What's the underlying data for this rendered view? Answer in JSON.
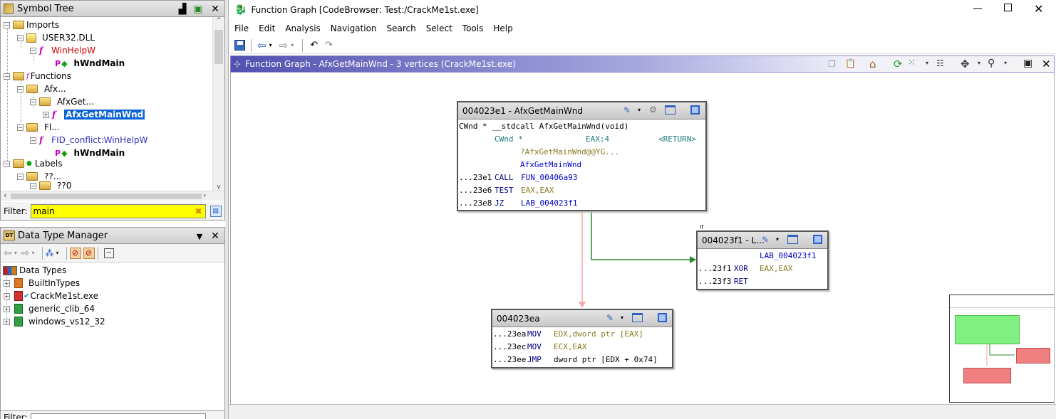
{
  "symbol_tree": {
    "title": "Symbol Tree",
    "items": [
      {
        "label": "Imports"
      },
      {
        "label": "USER32.DLL"
      },
      {
        "label": "WinHelpW"
      },
      {
        "label": "hWndMain"
      },
      {
        "label": "Functions"
      },
      {
        "label": "Afx..."
      },
      {
        "label": "AfxGet..."
      },
      {
        "label": "AfxGetMainWnd"
      },
      {
        "label": "Fl..."
      },
      {
        "label": "FID_conflict:WinHelpW"
      },
      {
        "label": "hWndMain"
      },
      {
        "label": "Labels"
      },
      {
        "label": "??..."
      },
      {
        "label": "??0"
      }
    ],
    "filter_label": "Filter:",
    "filter_value": "main"
  },
  "data_type_manager": {
    "title": "Data Type Manager",
    "root": "Data Types",
    "items": [
      {
        "label": "BuiltInTypes"
      },
      {
        "label": "CrackMe1st.exe"
      },
      {
        "label": "generic_clib_64"
      },
      {
        "label": "windows_vs12_32"
      }
    ],
    "filter_label": "Filter:"
  },
  "window": {
    "title": "Function Graph [CodeBrowser: Test:/CrackMe1st.exe]",
    "menu": [
      "File",
      "Edit",
      "Analysis",
      "Navigation",
      "Search",
      "Select",
      "Tools",
      "Help"
    ],
    "panel_title": "Function Graph - AfxGetMainWnd - 3 vertices  (CrackMe1st.exe)"
  },
  "graph": {
    "node1": {
      "title": "004023e1 - AfxGetMainWnd",
      "sig": "CWnd * __stdcall AfxGetMainWnd(void)",
      "ret_type": "CWnd *",
      "ret_loc": "EAX:4",
      "ret_name": "<RETURN>",
      "label1": "?AfxGetMainWnd@@YG...",
      "label2": "AfxGetMainWnd",
      "rows": [
        {
          "addr": "...23e1",
          "op": "CALL",
          "arg": "FUN_00406a93"
        },
        {
          "addr": "...23e6",
          "op": "TEST",
          "arg": "EAX,EAX"
        },
        {
          "addr": "...23e8",
          "op": "JZ",
          "arg": "LAB_004023f1"
        }
      ]
    },
    "node2": {
      "tag": "lf",
      "title": "004023f1 - L...",
      "label": "LAB_004023f1",
      "rows": [
        {
          "addr": "...23f1",
          "op": "XOR",
          "arg": "EAX,EAX"
        },
        {
          "addr": "...23f3",
          "op": "RET",
          "arg": ""
        }
      ]
    },
    "node3": {
      "title": "004023ea",
      "rows": [
        {
          "addr": "...23ea",
          "op": "MOV",
          "arg": "EDX,dword ptr [EAX]"
        },
        {
          "addr": "...23ec",
          "op": "MOV",
          "arg": "ECX,EAX"
        },
        {
          "addr": "...23ee",
          "op": "JMP",
          "arg": "dword ptr [EDX + 0x74]"
        }
      ]
    }
  },
  "colors": {
    "selected": "#0a64d8",
    "filter_bg": "#ffff00",
    "edge_true": "#2a8a2a",
    "edge_fall": "#f0a0a0",
    "sat_entry": "#80f080",
    "sat_exit": "#f08080"
  }
}
